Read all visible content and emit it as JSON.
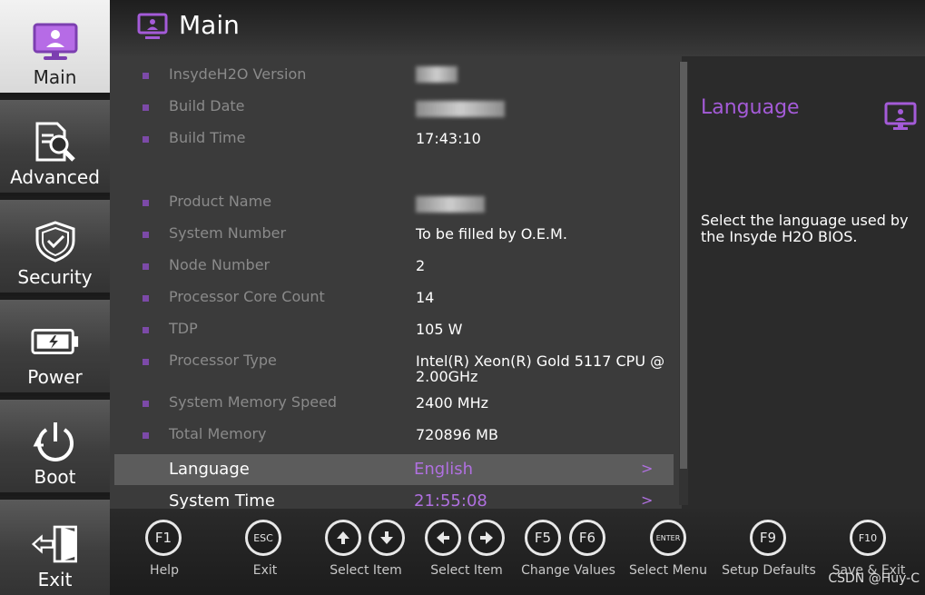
{
  "sidebar": {
    "items": [
      {
        "label": "Main",
        "icon": "monitor-icon",
        "active": true
      },
      {
        "label": "Advanced",
        "icon": "document-search-icon",
        "active": false
      },
      {
        "label": "Security",
        "icon": "shield-check-icon",
        "active": false
      },
      {
        "label": "Power",
        "icon": "battery-icon",
        "active": false
      },
      {
        "label": "Boot",
        "icon": "power-icon",
        "active": false
      },
      {
        "label": "Exit",
        "icon": "exit-door-icon",
        "active": false
      }
    ]
  },
  "header": {
    "title": "Main",
    "icon": "monitor-icon"
  },
  "info_rows": [
    {
      "label": "InsydeH2O Version",
      "value": ""
    },
    {
      "label": "Build Date",
      "value": ""
    },
    {
      "label": "Build Time",
      "value": "17:43:10"
    },
    {
      "label": "Product Name",
      "value": ""
    },
    {
      "label": "System Number",
      "value": "To be filled by O.E.M."
    },
    {
      "label": "Node Number",
      "value": "2"
    },
    {
      "label": "Processor Core Count",
      "value": "14"
    },
    {
      "label": "TDP",
      "value": "105 W"
    },
    {
      "label": "Processor Type",
      "value": "Intel(R) Xeon(R) Gold 5117 CPU @\n2.00GHz"
    },
    {
      "label": "System Memory Speed",
      "value": "2400 MHz"
    },
    {
      "label": "Total Memory",
      "value": "720896 MB"
    }
  ],
  "options": [
    {
      "label": "Language",
      "value": "English",
      "arrow": ">"
    },
    {
      "label": "System Time",
      "value": "21:55:08",
      "arrow": ">"
    }
  ],
  "help": {
    "title": "Language",
    "text": "Select the language used by the Insyde H2O BIOS."
  },
  "keys": [
    {
      "key": "F1",
      "label": "Help"
    },
    {
      "key": "ESC",
      "label": "Exit"
    },
    {
      "key": "↑↓",
      "label": "Select Item"
    },
    {
      "key": "←→",
      "label": "Select Item"
    },
    {
      "key": "F5F6",
      "label": "Change Values"
    },
    {
      "key": "ENTER",
      "label": "Select Menu"
    },
    {
      "key": "F9",
      "label": "Setup Defaults"
    },
    {
      "key": "F10",
      "label": "Save & Exit"
    }
  ],
  "watermark": "CSDN @Huy-C",
  "colors": {
    "accent": "#a45bd8",
    "bullet": "#7c4aa8",
    "selected_row": "#5c5c5c"
  }
}
